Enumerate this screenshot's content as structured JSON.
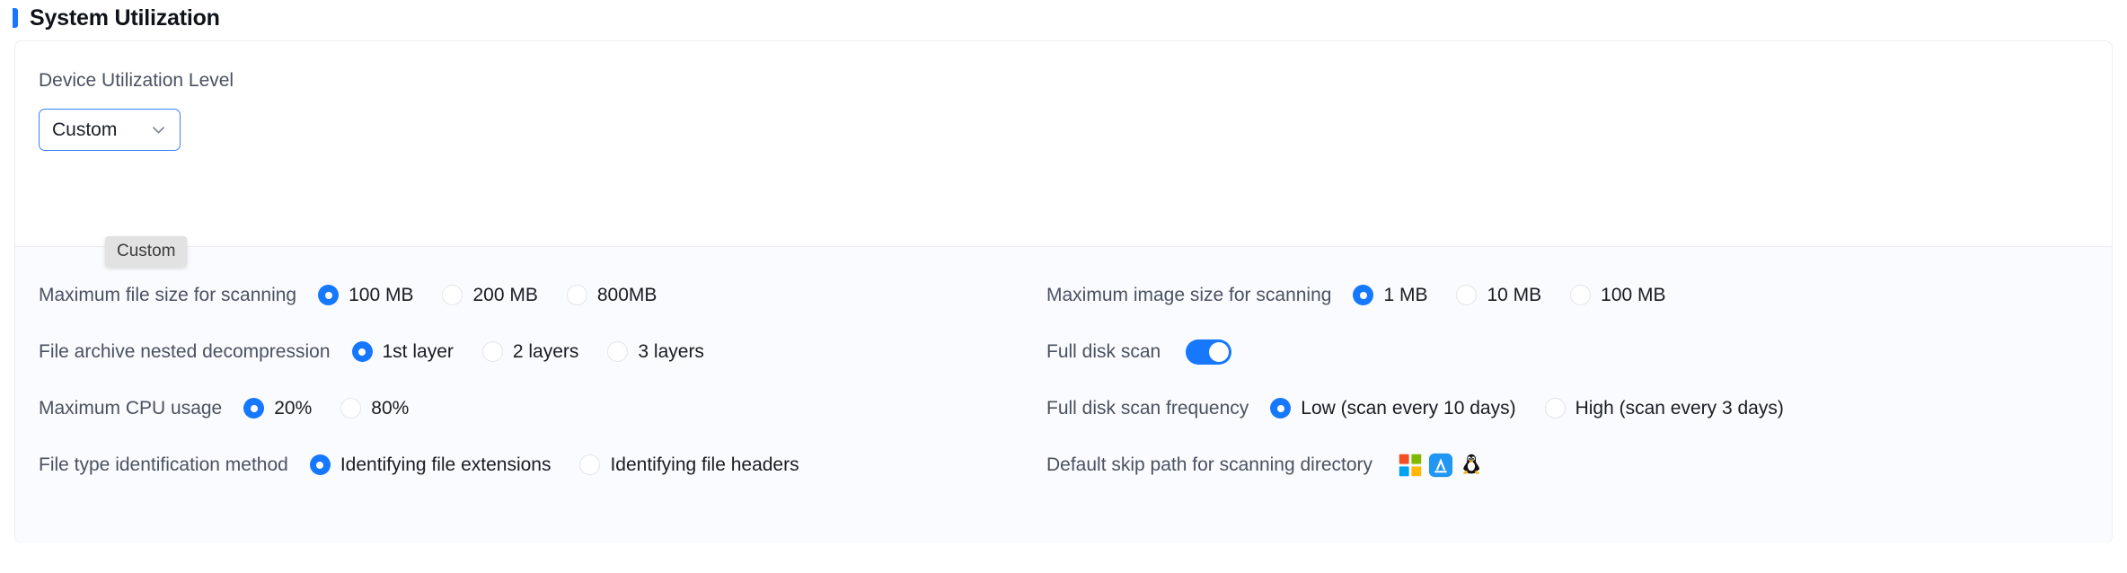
{
  "section": {
    "title": "System Utilization",
    "accent_color": "#1677ff"
  },
  "device_utilization": {
    "label": "Device Utilization Level",
    "selected": "Custom",
    "chevron_icon": "chevron-down-icon"
  },
  "tooltip": {
    "text": "Custom"
  },
  "rows": [
    {
      "left": {
        "label": "Maximum file size for scanning",
        "type": "radio-group",
        "options": [
          {
            "label": "100 MB",
            "selected": true
          },
          {
            "label": "200 MB",
            "selected": false
          },
          {
            "label": "800MB",
            "selected": false
          }
        ]
      },
      "right": {
        "label": "Maximum image size for scanning",
        "type": "radio-group",
        "options": [
          {
            "label": "1 MB",
            "selected": true
          },
          {
            "label": "10 MB",
            "selected": false
          },
          {
            "label": "100 MB",
            "selected": false
          }
        ]
      }
    },
    {
      "left": {
        "label": "File archive nested decompression",
        "type": "radio-group",
        "options": [
          {
            "label": "1st layer",
            "selected": true
          },
          {
            "label": "2 layers",
            "selected": false
          },
          {
            "label": "3 layers",
            "selected": false
          }
        ]
      },
      "right": {
        "label": "Full disk scan",
        "type": "toggle",
        "toggle_on": true
      }
    },
    {
      "left": {
        "label": "Maximum CPU usage",
        "type": "radio-group",
        "options": [
          {
            "label": "20%",
            "selected": true
          },
          {
            "label": "80%",
            "selected": false
          }
        ]
      },
      "right": {
        "label": "Full disk scan frequency",
        "type": "radio-group",
        "options": [
          {
            "label": "Low (scan every 10 days)",
            "selected": true
          },
          {
            "label": "High (scan every 3 days)",
            "selected": false
          }
        ]
      }
    },
    {
      "left": {
        "label": "File type identification method",
        "type": "radio-group",
        "options": [
          {
            "label": "Identifying file extensions",
            "selected": true
          },
          {
            "label": "Identifying file headers",
            "selected": false
          }
        ]
      },
      "right": {
        "label": "Default skip path for scanning directory",
        "type": "os-icons",
        "icons": [
          "windows-icon",
          "apple-appstore-icon",
          "linux-tux-icon"
        ]
      }
    }
  ]
}
